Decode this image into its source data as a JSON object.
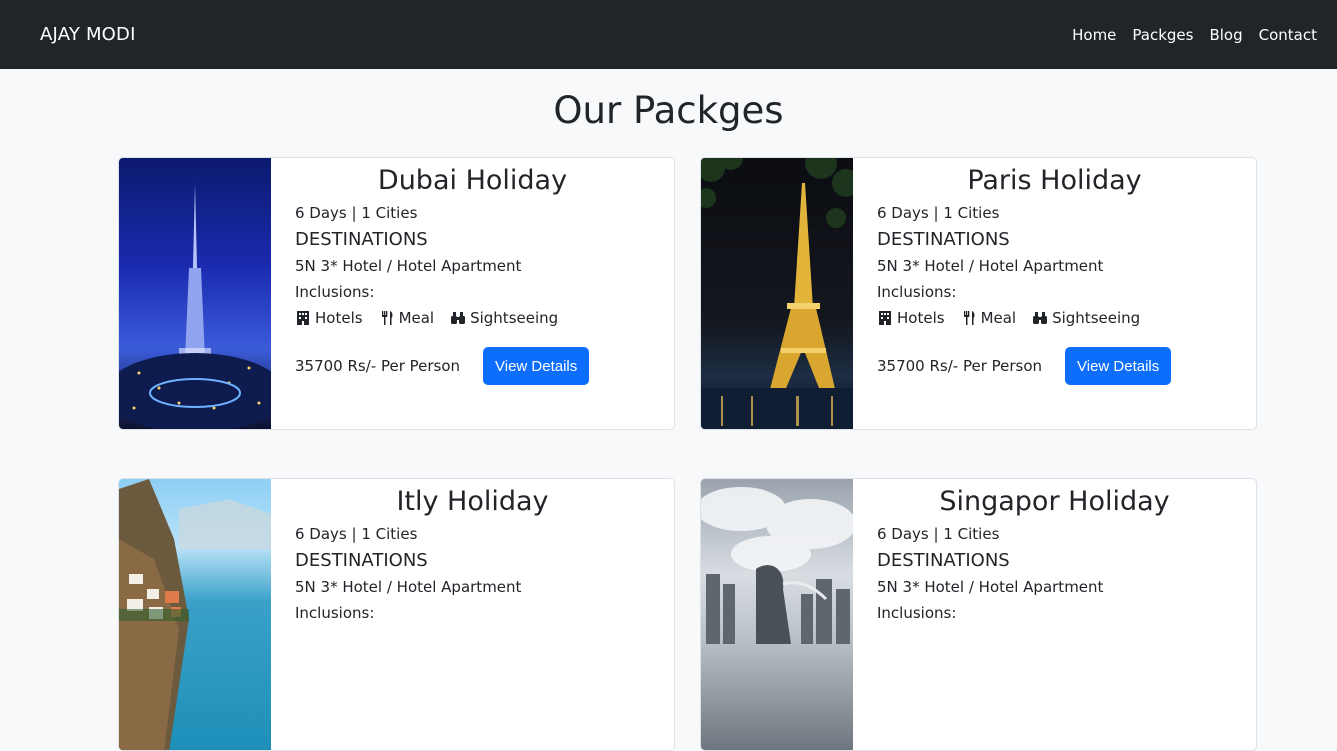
{
  "navbar": {
    "brand": "AJAY MODI",
    "links": [
      "Home",
      "Packges",
      "Blog",
      "Contact"
    ]
  },
  "page": {
    "title": "Our Packges"
  },
  "packages": [
    {
      "title": "Dubai Holiday",
      "meta": "6 Days | 1 Cities",
      "destinations": "DESTINATIONS",
      "hotel": "5N 3* Hotel / Hotel Apartment",
      "inclusions_label": "Inclusions:",
      "amenities": [
        "Hotels",
        "Meal",
        "Sightseeing"
      ],
      "price": "35700 Rs/- Per Person",
      "button": "View Details"
    },
    {
      "title": "Paris Holiday",
      "meta": "6 Days | 1 Cities",
      "destinations": "DESTINATIONS",
      "hotel": "5N 3* Hotel / Hotel Apartment",
      "inclusions_label": "Inclusions:",
      "amenities": [
        "Hotels",
        "Meal",
        "Sightseeing"
      ],
      "price": "35700 Rs/- Per Person",
      "button": "View Details"
    },
    {
      "title": "Itly Holiday",
      "meta": "6 Days | 1 Cities",
      "destinations": "DESTINATIONS",
      "hotel": "5N 3* Hotel / Hotel Apartment",
      "inclusions_label": "Inclusions:"
    },
    {
      "title": "Singapor Holiday",
      "meta": "6 Days | 1 Cities",
      "destinations": "DESTINATIONS",
      "hotel": "5N 3* Hotel / Hotel Apartment",
      "inclusions_label": "Inclusions:"
    }
  ],
  "colors": {
    "navbar": "#212529",
    "primary_button": "#0d6efd",
    "background": "#f8f9fa"
  }
}
